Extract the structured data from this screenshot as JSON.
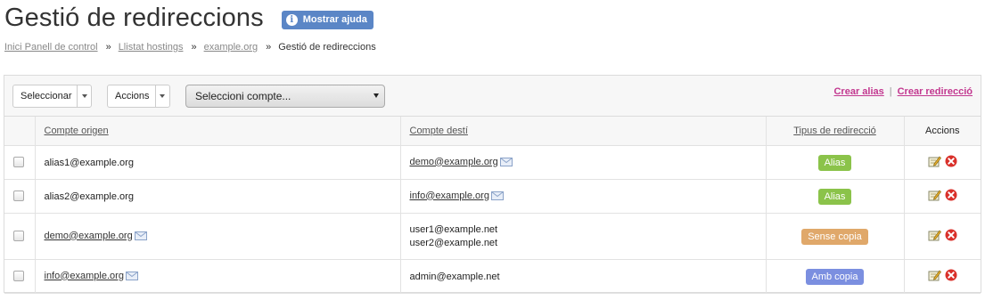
{
  "header": {
    "title": "Gestió de redireccions",
    "help_button": "Mostrar ajuda",
    "help_icon": "info-icon"
  },
  "breadcrumb": {
    "items": [
      "Inici Panell de control",
      "Llistat hostings",
      "example.org"
    ],
    "separator": "»",
    "current": "Gestió de redireccions"
  },
  "toolbar": {
    "select_label": "Seleccionar",
    "actions_label": "Accions",
    "account_select": {
      "selected": "Seleccioni compte..."
    },
    "create_alias": "Crear alias",
    "create_redirect": "Crear redirecció",
    "link_separator": "|"
  },
  "table": {
    "columns": [
      "Compte origen",
      "Compte destí",
      "Tipus de redirecció",
      "Accions"
    ],
    "rows": [
      {
        "origin": "alias1@example.org",
        "origin_link": false,
        "dest": [
          "demo@example.org"
        ],
        "dest_link": true,
        "type": "Alias",
        "type_color": "#8bc34a"
      },
      {
        "origin": "alias2@example.org",
        "origin_link": false,
        "dest": [
          "info@example.org"
        ],
        "dest_link": true,
        "type": "Alias",
        "type_color": "#8bc34a"
      },
      {
        "origin": "demo@example.org",
        "origin_link": true,
        "dest": [
          "user1@example.net",
          "user2@example.net"
        ],
        "dest_link": false,
        "type": "Sense copia",
        "type_color": "#e0a86a"
      },
      {
        "origin": "info@example.org",
        "origin_link": true,
        "dest": [
          "admin@example.net"
        ],
        "dest_link": false,
        "type": "Amb copia",
        "type_color": "#7b8fe0"
      }
    ],
    "row_actions": [
      "edit-icon",
      "delete-icon"
    ]
  },
  "colors": {
    "accent_link": "#c2378f",
    "help_button": "#5b86c6",
    "delete": "#d9302a"
  }
}
